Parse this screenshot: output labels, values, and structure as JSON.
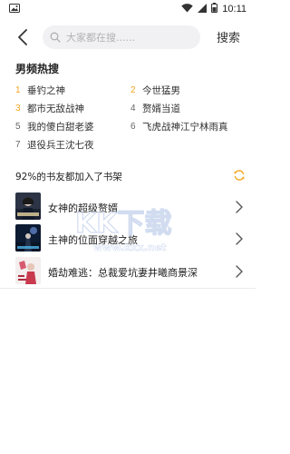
{
  "status_bar": {
    "time": "10:11"
  },
  "header": {
    "search_placeholder": "大家都在搜......",
    "search_action": "搜索"
  },
  "hot": {
    "title": "男频热搜",
    "items": [
      {
        "rank": "1",
        "label": "垂钓之神"
      },
      {
        "rank": "2",
        "label": "今世猛男"
      },
      {
        "rank": "3",
        "label": "都市无敌战神"
      },
      {
        "rank": "4",
        "label": "赘婿当道"
      },
      {
        "rank": "5",
        "label": "我的傻白甜老婆"
      },
      {
        "rank": "6",
        "label": "飞虎战神江宁林雨真"
      },
      {
        "rank": "7",
        "label": "退役兵王沈七夜"
      }
    ]
  },
  "shelf": {
    "title": "92%的书友都加入了书架",
    "books": [
      {
        "title": "女神的超级赘婿"
      },
      {
        "title": "主神的位面穿越之旅"
      },
      {
        "title": "婚劫难逃：总裁爱坑妻井曦商景深"
      }
    ]
  },
  "watermark": {
    "brand": "KK下载",
    "url": "www.kkx.net"
  },
  "colors": {
    "rank_hot": "#f5a623",
    "rank_normal": "#666666",
    "search_bg": "#f1f1f3",
    "refresh_icon": "#f5a623"
  }
}
